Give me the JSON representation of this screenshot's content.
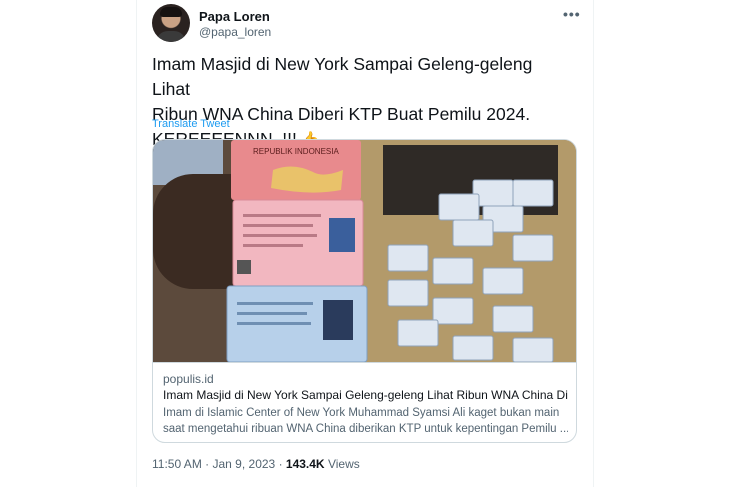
{
  "author": {
    "name": "Papa Loren",
    "handle": "@papa_loren",
    "more_icon": "more-horizontal-icon"
  },
  "tweet": {
    "text_line1": "Imam Masjid di New York Sampai Geleng-geleng Lihat",
    "text_line2": "Ribun WNA China Diberi KTP Buat Pemilu 2024.",
    "text_line3": "KEREEEENNN..!!!",
    "emoji": "👍",
    "translate_label": "Translate Tweet"
  },
  "card": {
    "image_icon": "photo-id-cards",
    "card_header_text": "REPUBLIK INDONESIA",
    "domain": "populis.id",
    "title": "Imam Masjid di New York Sampai Geleng-geleng Lihat Ribun WNA China Diberi ...",
    "desc_line1": "Imam di Islamic Center of New York Muhammad Syamsi Ali kaget bukan main",
    "desc_line2": "saat mengetahui ribuan WNA China diberikan KTP untuk kepentingan Pemilu ..."
  },
  "meta": {
    "time": "11:50 AM",
    "date": "Jan 9, 2023",
    "separator": "·",
    "views_count": "143.4K",
    "views_label": "Views"
  }
}
